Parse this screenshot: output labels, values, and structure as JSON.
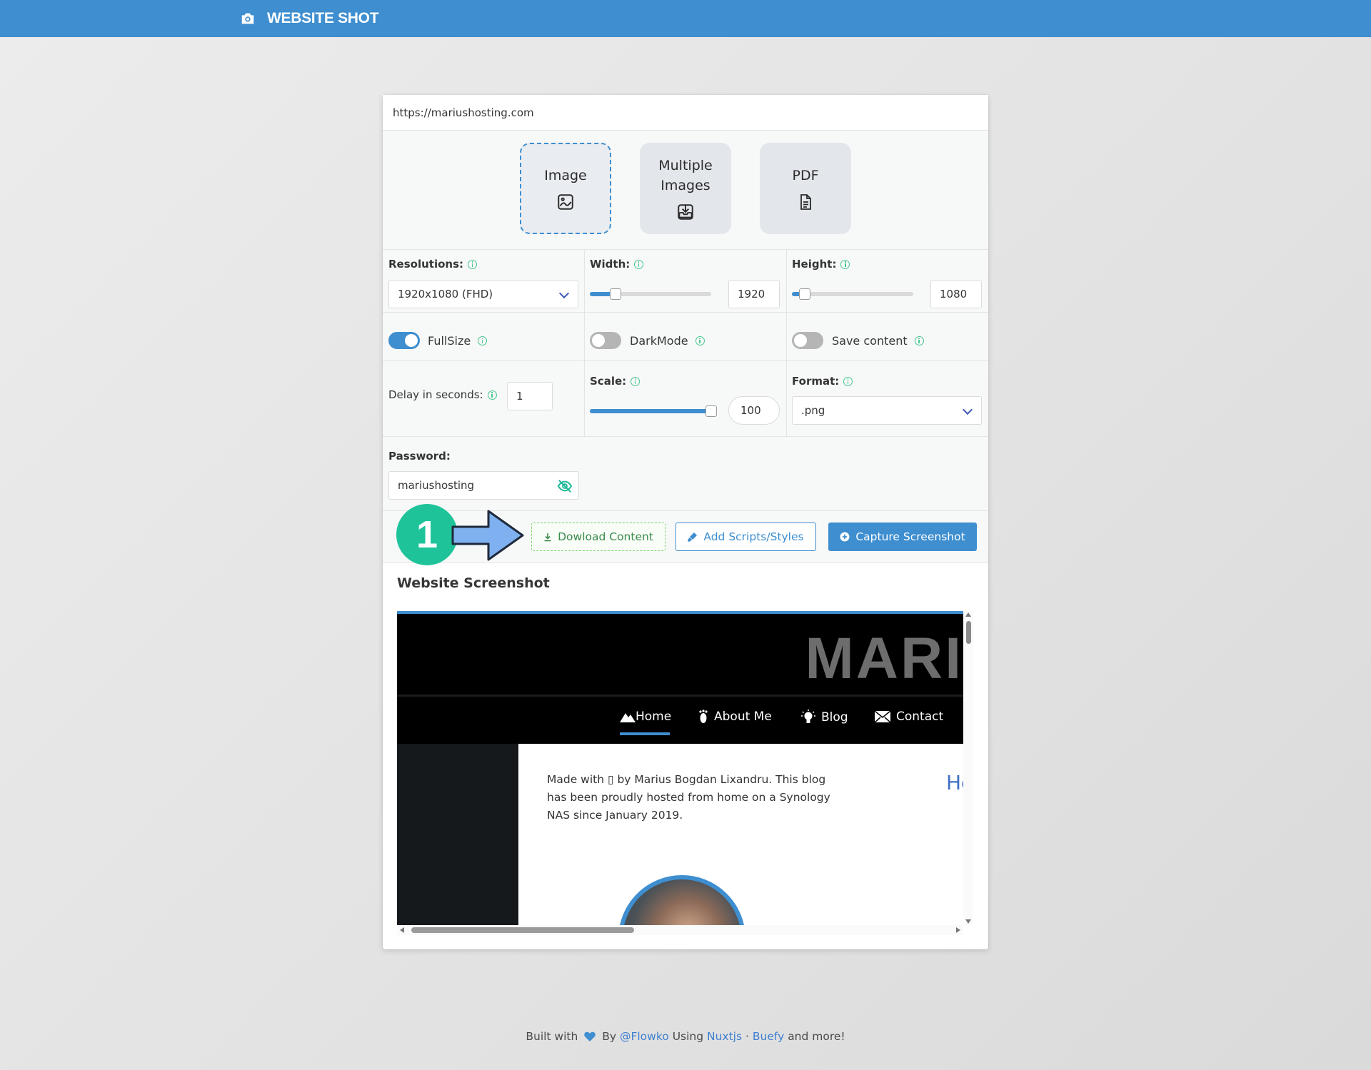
{
  "navbar": {
    "title": "WEBSITE SHOT",
    "icon": "camera-icon"
  },
  "url": {
    "value": "https://mariushosting.com"
  },
  "modes": [
    {
      "label": "Image",
      "icon": "image-icon",
      "active": true
    },
    {
      "label": "Multiple Images",
      "icon": "tray-download-icon",
      "active": false
    },
    {
      "label": "PDF",
      "icon": "document-icon",
      "active": false
    }
  ],
  "resolution": {
    "label": "Resolutions:",
    "value": "1920x1080 (FHD)"
  },
  "width": {
    "label": "Width:",
    "value": "1920"
  },
  "height": {
    "label": "Height:",
    "value": "1080"
  },
  "toggles": {
    "fullsize": {
      "label": "FullSize",
      "on": true
    },
    "darkmode": {
      "label": "DarkMode",
      "on": false
    },
    "savecontent": {
      "label": "Save content",
      "on": false
    }
  },
  "delay": {
    "label": "Delay in seconds:",
    "value": "1"
  },
  "scale": {
    "label": "Scale:",
    "value": "100"
  },
  "format": {
    "label": "Format:",
    "value": ".png"
  },
  "password": {
    "label": "Password:",
    "value": "mariushosting"
  },
  "buttons": {
    "download": "Dowload Content",
    "add_scripts": "Add Scripts/Styles",
    "capture": "Capture Screenshot"
  },
  "annotation": {
    "number": "1",
    "color": "#1fc39a"
  },
  "screenshot": {
    "title": "Website Screenshot",
    "logo": "MARI",
    "nav": [
      "Home",
      "About Me",
      "Blog",
      "Contact"
    ],
    "made_text": "Made with ▯ by Marius Bogdan Lixandru. This blog has been proudly hosted from home on a Synology NAS since January 2019.",
    "heading_fragment": "Hc"
  },
  "footer": {
    "built": "Built with",
    "by": "By",
    "author": "@Flowko",
    "using": "Using",
    "nuxt": "Nuxtjs",
    "dot": "·",
    "buefy": "Buefy",
    "more": "and more!"
  },
  "colors": {
    "primary": "#3e8ed0",
    "success": "#48c78e",
    "annotation": "#1fc39a"
  }
}
